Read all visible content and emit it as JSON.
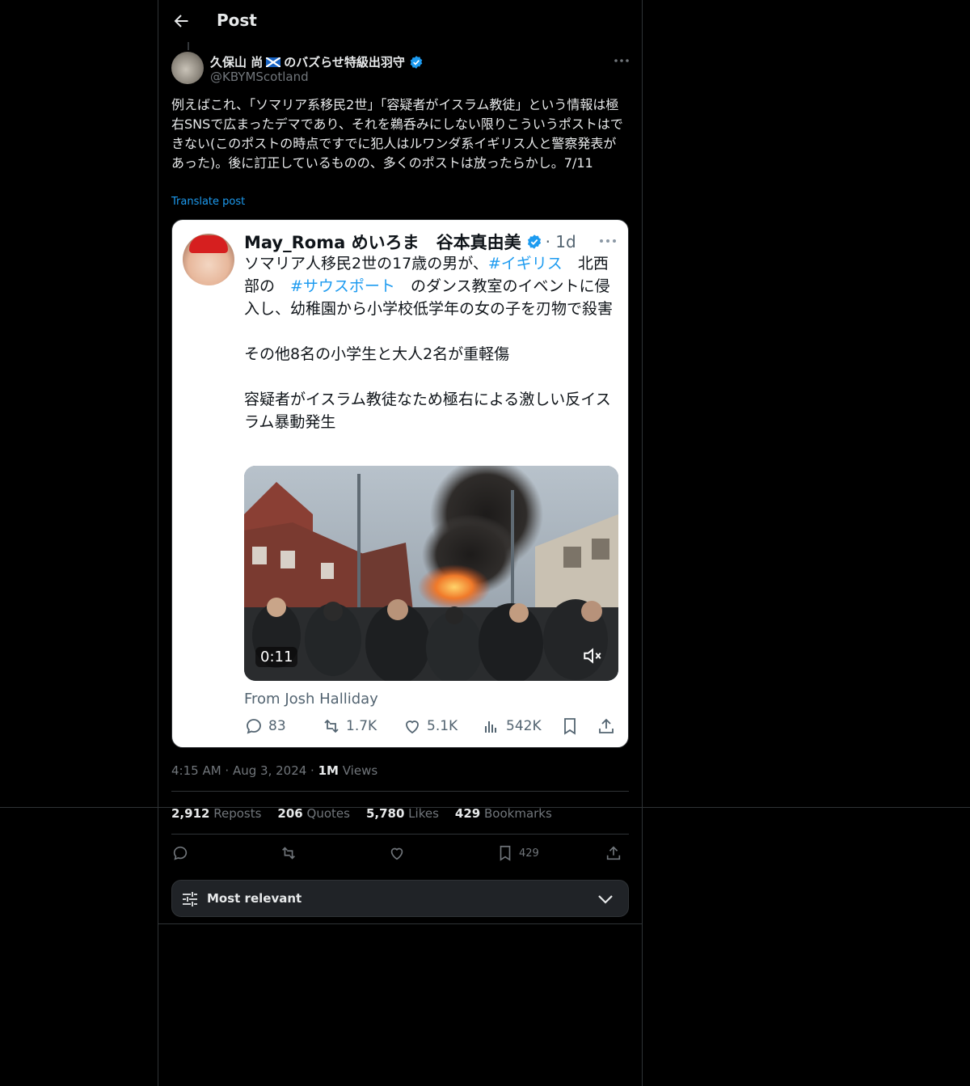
{
  "header": {
    "title": "Post"
  },
  "author": {
    "display_name_prefix": "久保山 尚",
    "display_name_suffix": "のバズらせ特級出羽守",
    "handle": "@KBYMScotland"
  },
  "post": {
    "text": "例えばこれ、「ソマリア系移民2世」「容疑者がイスラム教徒」という情報は極右SNSで広まったデマであり、それを鵜呑みにしない限りこういうポストはできない(このポストの時点ですでに犯人はルワンダ系イギリス人と警察発表があった)。後に訂正しているものの、多くのポストは放ったらかし。7/11",
    "translate": "Translate post"
  },
  "quoted": {
    "name": "May_Roma めいろま　谷本真由美",
    "time": "· 1d",
    "text_1": "ソマリア人移民2世の17歳の男が、",
    "hashtag_1": "#イギリス",
    "text_2": "　北西部の　",
    "hashtag_2": "#サウスポート",
    "text_3": "　のダンス教室のイベントに侵入し、幼稚園から小学校低学年の女の子を刃物で殺害\n\nその他8名の小学生と大人2名が重軽傷\n\n容疑者がイスラム教徒なため極右による激しい反イスラム暴動発生",
    "video_duration": "0:11",
    "from": "From Josh Halliday",
    "replies": "83",
    "reposts": "1.7K",
    "likes": "5.1K",
    "views": "542K"
  },
  "meta": {
    "time": "4:15 AM",
    "dot1": " · ",
    "date": "Aug 3, 2024",
    "dot2": " · ",
    "views_count": "1M",
    "views_label": " Views"
  },
  "stats": {
    "reposts_count": "2,912",
    "reposts_label": "Reposts",
    "quotes_count": "206",
    "quotes_label": "Quotes",
    "likes_count": "5,780",
    "likes_label": "Likes",
    "bookmarks_count": "429",
    "bookmarks_label": "Bookmarks"
  },
  "actions": {
    "bookmark_count": "429"
  },
  "sort": {
    "label": "Most relevant"
  },
  "colors": {
    "accent": "#1d9bf0",
    "background": "#000000",
    "text": "#e7e9ea",
    "muted": "#71767b",
    "border": "#2f3336"
  },
  "icons": [
    "back-arrow-icon",
    "verified-badge-icon",
    "more-icon",
    "reply-icon",
    "repost-icon",
    "like-icon",
    "views-icon",
    "bookmark-icon",
    "share-icon",
    "mute-icon",
    "sliders-icon",
    "chevron-down-icon"
  ]
}
